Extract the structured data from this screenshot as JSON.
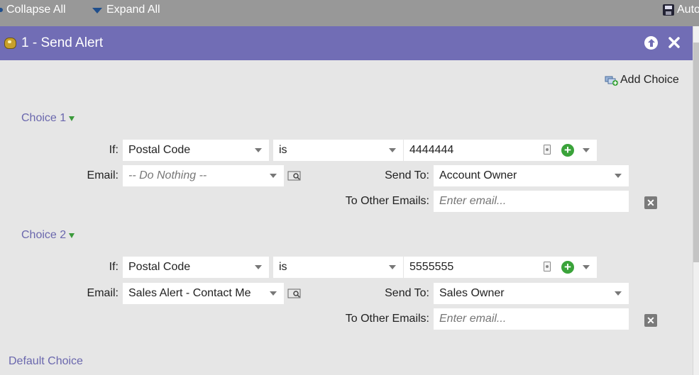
{
  "toolbar": {
    "collapse_all": "Collapse All",
    "expand_all": "Expand All",
    "auto_save": "Auto"
  },
  "step": {
    "title": "1 - Send Alert"
  },
  "add_choice_label": "Add Choice",
  "choices": [
    {
      "label": "Choice 1",
      "if_label": "If:",
      "if_field": "Postal Code",
      "operator": "is",
      "value": "4444444",
      "email_label": "Email:",
      "email_value": "-- Do Nothing --",
      "send_to_label": "Send To:",
      "send_to_value": "Account Owner",
      "other_emails_label": "To Other Emails:",
      "other_emails_placeholder": "Enter email..."
    },
    {
      "label": "Choice 2",
      "if_label": "If:",
      "if_field": "Postal Code",
      "operator": "is",
      "value": "5555555",
      "email_label": "Email:",
      "email_value": "Sales Alert - Contact Me",
      "send_to_label": "Send To:",
      "send_to_value": "Sales Owner",
      "other_emails_label": "To Other Emails:",
      "other_emails_placeholder": "Enter email..."
    }
  ],
  "default_choice_label": "Default Choice",
  "colors": {
    "header_bg": "#716db5",
    "link": "#6a67ad",
    "toolbar_bg": "#989898",
    "panel_bg": "#e6e6e6"
  }
}
